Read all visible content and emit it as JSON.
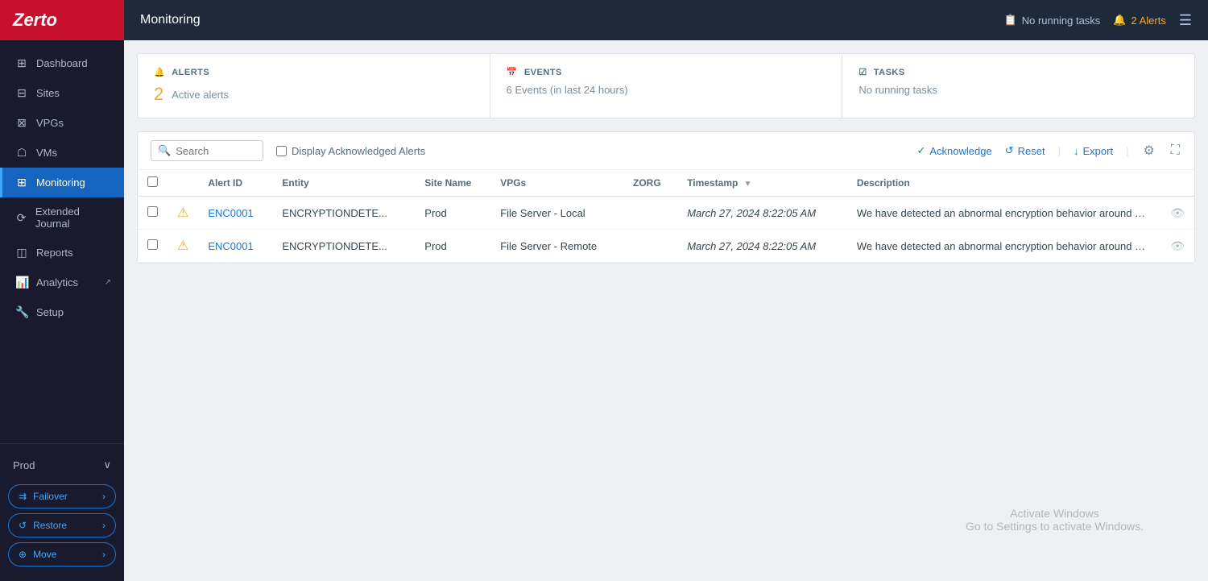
{
  "app": {
    "name": "Zerto",
    "page_title": "Monitoring"
  },
  "topbar": {
    "title": "Monitoring",
    "tasks_icon": "📋",
    "tasks_label": "No running tasks",
    "alerts_icon": "🔔",
    "alerts_label": "2 Alerts",
    "menu_icon": "☰"
  },
  "sidebar": {
    "logo": "Zerto",
    "nav_items": [
      {
        "id": "dashboard",
        "label": "Dashboard",
        "icon": "⊞",
        "active": false,
        "external": false
      },
      {
        "id": "sites",
        "label": "Sites",
        "icon": "⊟",
        "active": false,
        "external": false
      },
      {
        "id": "vpgs",
        "label": "VPGs",
        "icon": "⊠",
        "active": false,
        "external": false
      },
      {
        "id": "vms",
        "label": "VMs",
        "icon": "☖",
        "active": false,
        "external": false
      },
      {
        "id": "monitoring",
        "label": "Monitoring",
        "icon": "⊞",
        "active": true,
        "external": false
      },
      {
        "id": "extended-journal",
        "label": "Extended Journal",
        "icon": "⟳",
        "active": false,
        "external": false
      },
      {
        "id": "reports",
        "label": "Reports",
        "icon": "◫",
        "active": false,
        "external": false
      },
      {
        "id": "analytics",
        "label": "Analytics",
        "icon": "📊",
        "active": false,
        "external": true
      }
    ],
    "setup": {
      "label": "Setup",
      "icon": "🔧"
    },
    "env": {
      "label": "Prod",
      "chevron": "∨"
    },
    "actions": [
      {
        "id": "failover",
        "label": "Failover",
        "icon": "⇉"
      },
      {
        "id": "restore",
        "label": "Restore",
        "icon": "↺"
      },
      {
        "id": "move",
        "label": "Move",
        "icon": "⊕"
      }
    ]
  },
  "summary_cards": [
    {
      "id": "alerts",
      "header_icon": "🔔",
      "header_label": "ALERTS",
      "count": "2",
      "count_label": "Active alerts"
    },
    {
      "id": "events",
      "header_icon": "📅",
      "header_label": "EVENTS",
      "events_text": "6 Events (in last 24 hours)"
    },
    {
      "id": "tasks",
      "header_icon": "☑",
      "header_label": "TASKS",
      "tasks_text": "No running tasks"
    }
  ],
  "toolbar": {
    "search_placeholder": "Search",
    "ack_checkbox_label": "Display Acknowledged Alerts",
    "acknowledge_label": "Acknowledge",
    "reset_label": "Reset",
    "export_label": "Export"
  },
  "table": {
    "columns": [
      {
        "id": "check",
        "label": ""
      },
      {
        "id": "warn",
        "label": ""
      },
      {
        "id": "alert_id",
        "label": "Alert ID"
      },
      {
        "id": "entity",
        "label": "Entity"
      },
      {
        "id": "site_name",
        "label": "Site Name"
      },
      {
        "id": "vpgs",
        "label": "VPGs"
      },
      {
        "id": "zorg",
        "label": "ZORG"
      },
      {
        "id": "timestamp",
        "label": "Timestamp",
        "sortable": true
      },
      {
        "id": "description",
        "label": "Description"
      }
    ],
    "rows": [
      {
        "id": 1,
        "alert_id": "ENC0001",
        "entity": "ENCRYPTIONDETE...",
        "site_name": "Prod",
        "vpgs": "File Server - Local",
        "zorg": "",
        "timestamp": "March 27, 2024 8:22:05 AM",
        "description": "We have detected an abnormal encryption behavior around VPG: File Server - Local. This..."
      },
      {
        "id": 2,
        "alert_id": "ENC0001",
        "entity": "ENCRYPTIONDETE...",
        "site_name": "Prod",
        "vpgs": "File Server - Remote",
        "zorg": "",
        "timestamp": "March 27, 2024 8:22:05 AM",
        "description": "We have detected an abnormal encryption behavior around VPG: File Server - Remote. T..."
      }
    ]
  },
  "watermark": {
    "line1": "Activate Windows",
    "line2": "Go to Settings to activate Windows."
  }
}
